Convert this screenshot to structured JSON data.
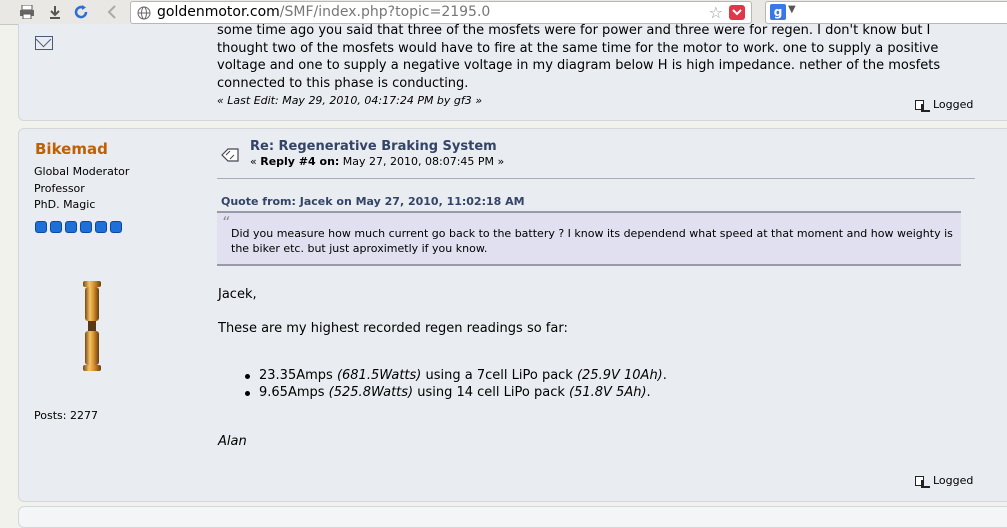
{
  "browser": {
    "url_domain": "goldenmotor.com",
    "url_path": "/SMF/index.php?topic=2195.0",
    "search_engine_letter": "g"
  },
  "post1": {
    "text": "some time ago you said that three of the mosfets were for power and three were for regen. I don't know but I thought two of the mosfets would have to fire at the same time for the motor to work. one to supply a positive voltage and one to supply a negative voltage in my diagram below H is high impedance. nether of the mosfets connected to this phase is conducting.",
    "last_edit": "« Last Edit: May 29, 2010, 04:17:24 PM by gf3 »",
    "logged": "Logged"
  },
  "post2": {
    "poster_name": "Bikemad",
    "poster_titles": [
      "Global Moderator",
      "Professor",
      "PhD. Magic"
    ],
    "star_count": 6,
    "posts_label": "Posts: 2277",
    "subject": "Re: Regenerative Braking System",
    "reply_prefix": "«",
    "reply_label": "Reply #4 on:",
    "reply_date": "May 27, 2010, 08:07:45 PM »",
    "quote_header": "Quote from: Jacek on May 27, 2010, 11:02:18 AM",
    "quote_text": "Did you measure how much current go back to the battery ? I know its dependend what speed at that moment and how weighty is the biker etc. but just aproximetly if you know.",
    "greeting": "Jacek,",
    "intro": "These are my highest recorded regen readings so far:",
    "readings": [
      {
        "amps": "23.35Amps ",
        "watts": "(681.5Watts)",
        "mid": " using a 7cell LiPo pack ",
        "pack": "(25.9V 10Ah)",
        "end": "."
      },
      {
        "amps": "9.65Amps ",
        "watts": "(525.8Watts)",
        "mid": " using 14 cell LiPo pack ",
        "pack": "(51.8V 5Ah)",
        "end": "."
      }
    ],
    "signature": "Alan",
    "logged": "Logged"
  },
  "colors": {
    "poster_name": "#c06002",
    "subject": "#334466",
    "panel_bg": "#e9ecf0",
    "quote_bg": "#e0e0f0"
  }
}
